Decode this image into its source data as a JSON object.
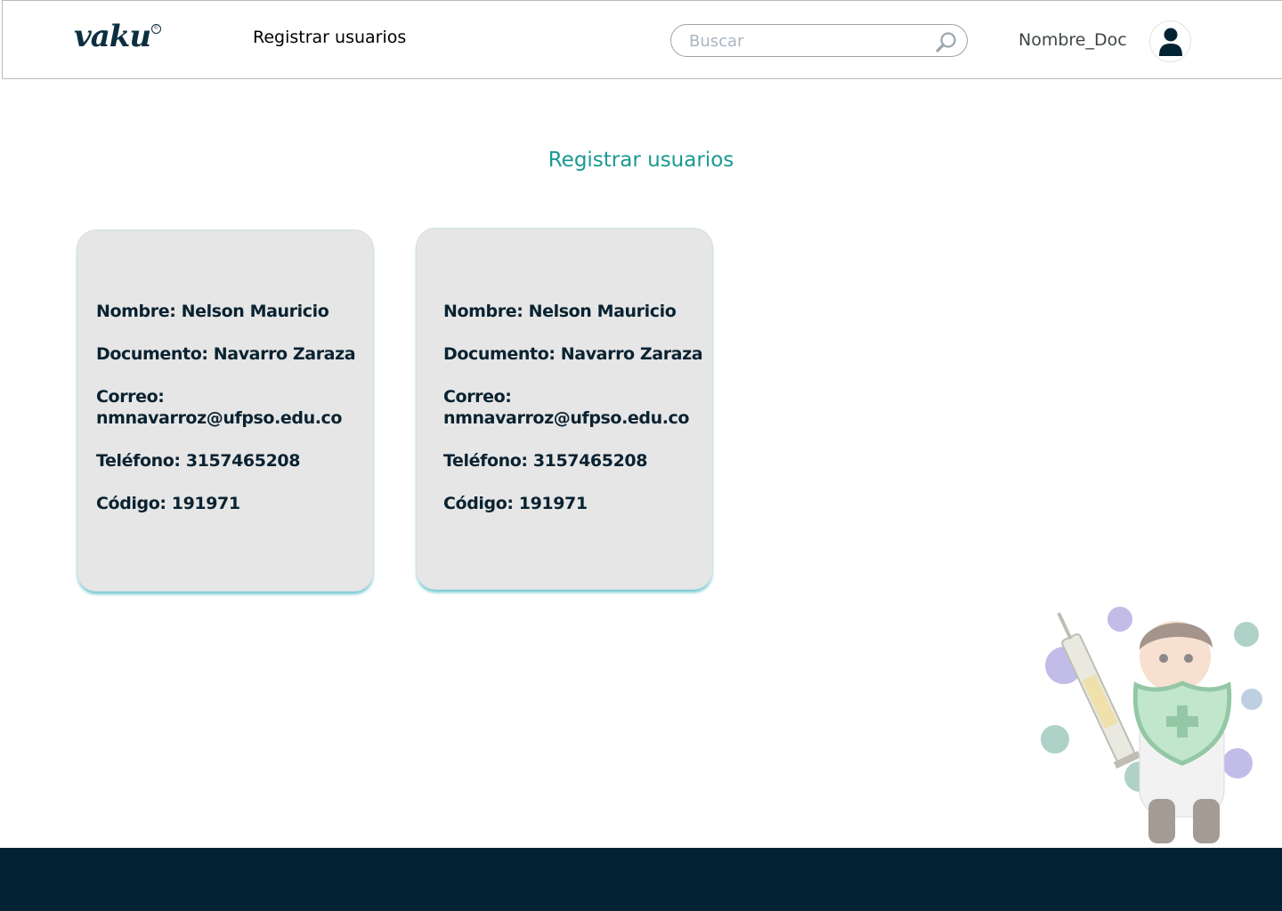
{
  "header": {
    "logo_text": "vaku",
    "logo_mark": "©",
    "nav_title": "Registrar usuarios",
    "search": {
      "placeholder": "Buscar",
      "value": "",
      "icon": "search-icon"
    },
    "username": "Nombre_Doc",
    "avatar_icon": "user-icon"
  },
  "main": {
    "title": "Registrar usuarios",
    "cards": [
      {
        "nombre": "Nombre: Nelson Mauricio",
        "documento": "Documento: Navarro Zaraza",
        "correo": "Correo: nmnavarroz@ufpso.edu.co",
        "telefono": "Teléfono: 3157465208",
        "codigo": "Código: 191971"
      },
      {
        "nombre": "Nombre: Nelson Mauricio",
        "documento": "Documento: Navarro Zaraza",
        "correo": "Correo: nmnavarroz@ufpso.edu.co",
        "telefono": "Teléfono: 3157465208",
        "codigo": "Código: 191971"
      }
    ]
  },
  "illustration": {
    "icon": "doctor-vaccine-illustration"
  },
  "colors": {
    "accent": "#1a9a91",
    "dark": "#022334",
    "card_bg": "#e6e6e6",
    "card_shadow": "#46b9c3"
  }
}
